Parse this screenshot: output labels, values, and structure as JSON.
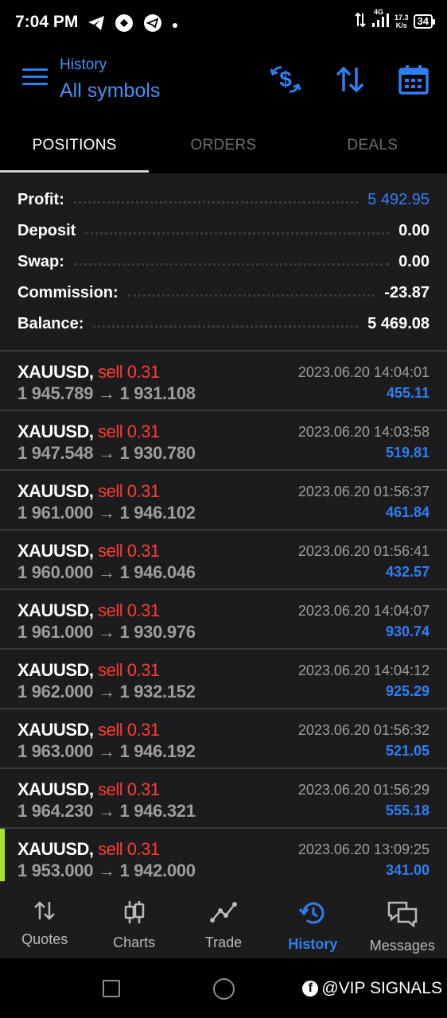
{
  "status": {
    "time": "7:04 PM",
    "net_type": "4G",
    "net_speed": "17.3",
    "net_unit": "K/s",
    "battery": "34"
  },
  "header": {
    "subtitle": "History",
    "title": "All symbols",
    "accent": "#2f7ff2"
  },
  "tabs": [
    "POSITIONS",
    "ORDERS",
    "DEALS"
  ],
  "summary": {
    "profit_label": "Profit:",
    "profit_value": "5 492.95",
    "deposit_label": "Deposit",
    "deposit_value": "0.00",
    "swap_label": "Swap:",
    "swap_value": "0.00",
    "commission_label": "Commission:",
    "commission_value": "-23.87",
    "balance_label": "Balance:",
    "balance_value": "5 469.08"
  },
  "deals": [
    {
      "symbol": "XAUUSD,",
      "type": "sell 0.31",
      "prices": "1 945.789 → 1 931.108",
      "time": "2023.06.20 14:04:01",
      "profit": "455.11"
    },
    {
      "symbol": "XAUUSD,",
      "type": "sell 0.31",
      "prices": "1 947.548 → 1 930.780",
      "time": "2023.06.20 14:03:58",
      "profit": "519.81"
    },
    {
      "symbol": "XAUUSD,",
      "type": "sell 0.31",
      "prices": "1 961.000 → 1 946.102",
      "time": "2023.06.20 01:56:37",
      "profit": "461.84"
    },
    {
      "symbol": "XAUUSD,",
      "type": "sell 0.31",
      "prices": "1 960.000 → 1 946.046",
      "time": "2023.06.20 01:56:41",
      "profit": "432.57"
    },
    {
      "symbol": "XAUUSD,",
      "type": "sell 0.31",
      "prices": "1 961.000 → 1 930.976",
      "time": "2023.06.20 14:04:07",
      "profit": "930.74"
    },
    {
      "symbol": "XAUUSD,",
      "type": "sell 0.31",
      "prices": "1 962.000 → 1 932.152",
      "time": "2023.06.20 14:04:12",
      "profit": "925.29"
    },
    {
      "symbol": "XAUUSD,",
      "type": "sell 0.31",
      "prices": "1 963.000 → 1 946.192",
      "time": "2023.06.20 01:56:32",
      "profit": "521.05"
    },
    {
      "symbol": "XAUUSD,",
      "type": "sell 0.31",
      "prices": "1 964.230 → 1 946.321",
      "time": "2023.06.20 01:56:29",
      "profit": "555.18"
    },
    {
      "symbol": "XAUUSD,",
      "type": "sell 0.31",
      "prices": "1 953.000 → 1 942.000",
      "time": "2023.06.20 13:09:25",
      "profit": "341.00"
    }
  ],
  "nav": [
    "Quotes",
    "Charts",
    "Trade",
    "History",
    "Messages"
  ],
  "watermark": "@VIP SIGNALS",
  "colors": {
    "sell": "#ff3b30",
    "profit": "#2f7ff2",
    "active_marker": "#a6e22e"
  }
}
